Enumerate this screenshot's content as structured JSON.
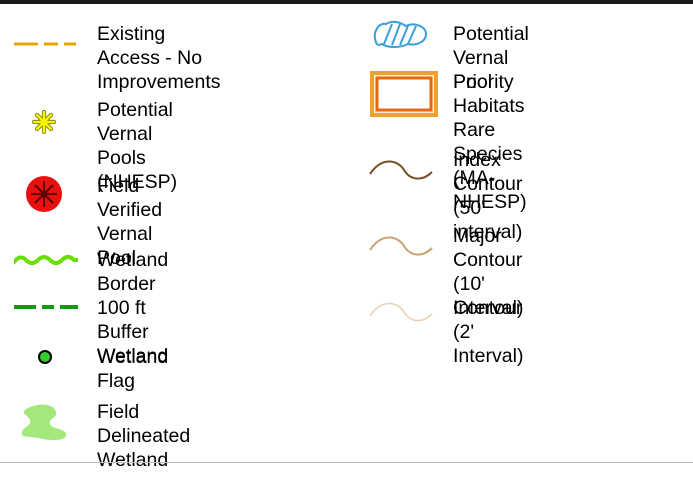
{
  "legend": {
    "left_column": [
      {
        "label": "Existing Access - No\nImprovements",
        "symbol": "dashed-yellow-line-icon"
      },
      {
        "label": "Potential Vernal Pools\n(NHESP)",
        "symbol": "yellow-asterisk-icon"
      },
      {
        "label": "Field Verified Vernal\nPool",
        "symbol": "red-asterisk-circle-icon"
      },
      {
        "label": "Wetland Border",
        "symbol": "green-wavy-line-icon"
      },
      {
        "label": "100 ft Buffer Wetland",
        "symbol": "green-dashed-line-icon"
      },
      {
        "label": "Wetland Flag",
        "symbol": "green-dot-icon"
      },
      {
        "label": "Field Delineated\nWetland",
        "symbol": "light-green-blob-icon"
      }
    ],
    "right_column": [
      {
        "label": "Potential Vernal Pool",
        "symbol": "blue-hatched-pool-icon"
      },
      {
        "label": "Priority Habitats Rare\nSpecies (MA-NHESP)",
        "symbol": "orange-rectangle-icon"
      },
      {
        "label": "Index Contour (50'\ninterval)",
        "symbol": "dark-brown-curve-icon"
      },
      {
        "label": "Major Contour (10'\nInterval)",
        "symbol": "tan-curve-icon"
      },
      {
        "label": "Contour (2' Interval)",
        "symbol": "light-tan-curve-icon"
      }
    ],
    "colors": {
      "access_line": "#e8a800",
      "nhesp_pool": "#f5f500",
      "verified_pool": "#e81010",
      "wetland_border": "#66e000",
      "buffer_line": "#109a10",
      "flag": "#33cc33",
      "delineated": "#a3e87a",
      "vernal_pool_blue": "#3aa0d8",
      "habitat_outer": "#f0a030",
      "habitat_inner": "#e86810",
      "index_contour": "#7a4e24",
      "major_contour": "#c9a36e",
      "minor_contour": "#e6d3b6"
    }
  }
}
